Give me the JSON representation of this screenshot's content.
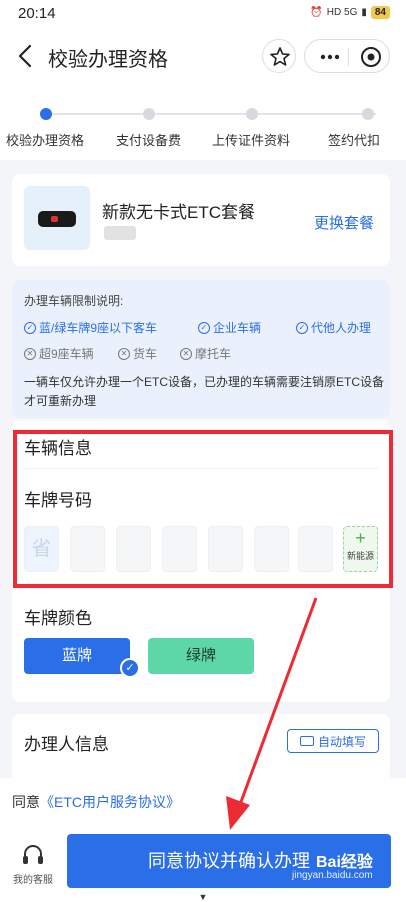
{
  "status_bar": {
    "time": "20:14",
    "network": "HD 5G",
    "battery": "84"
  },
  "nav": {
    "title": "校验办理资格"
  },
  "steps": [
    {
      "label": "校验办理资格",
      "active": true
    },
    {
      "label": "支付设备费",
      "active": false
    },
    {
      "label": "上传证件资料",
      "active": false
    },
    {
      "label": "签约代扣",
      "active": false
    }
  ],
  "package": {
    "name": "新款无卡式ETC套餐",
    "change_label": "更换套餐"
  },
  "notice": {
    "title": "办理车辆限制说明:",
    "allowed": [
      "蓝/绿车牌9座以下客车",
      "企业车辆",
      "代他人办理"
    ],
    "disallowed": [
      "超9座车辆",
      "货车",
      "摩托车"
    ],
    "text": "一辆车仅允许办理一个ETC设备，已办理的车辆需要注销原ETC设备才可重新办理"
  },
  "vehicle": {
    "section_title": "车辆信息",
    "plate_label": "车牌号码",
    "plate_placeholder": "省",
    "new_energy_label": "新能源",
    "color_label": "车牌颜色",
    "colors": [
      "蓝牌",
      "绿牌"
    ],
    "selected_color": "蓝牌"
  },
  "handler": {
    "title": "办理人信息",
    "autofill_label": "自动填写"
  },
  "agreement": {
    "prefix": "同意",
    "link": "《ETC用户服务协议》"
  },
  "bottom": {
    "service_label": "我的客服",
    "confirm_label": "同意协议并确认办理"
  },
  "watermark": {
    "brand": "Bai经验",
    "url": "jingyan.baidu.com"
  },
  "colors": {
    "accent": "#2a6ee8",
    "highlight": "#ee2b35",
    "green_plate": "#5dd7a8"
  }
}
